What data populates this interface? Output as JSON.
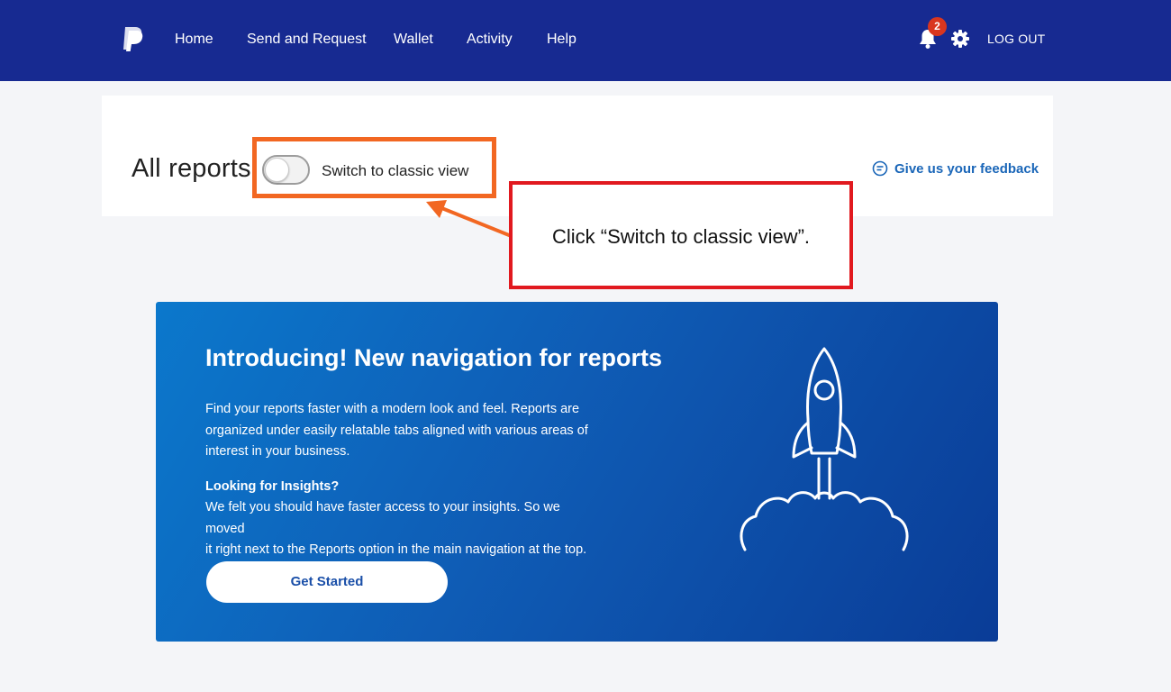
{
  "nav": {
    "items": [
      {
        "label": "Home"
      },
      {
        "label": "Send and Request"
      },
      {
        "label": "Wallet"
      },
      {
        "label": "Activity"
      },
      {
        "label": "Help"
      }
    ],
    "notification_count": "2",
    "logout_label": "LOG OUT",
    "icons": [
      "paypal-logo",
      "bell-icon",
      "gear-icon"
    ],
    "background_color": "#172a91"
  },
  "header": {
    "title": "All reports",
    "toggle_label": "Switch to classic view",
    "toggle_on": false,
    "feedback_label": "Give us your feedback"
  },
  "callout": {
    "text": "Click “Switch to classic view”.",
    "border_color": "#e1191f",
    "highlight_color": "#f26722"
  },
  "banner": {
    "title": "Introducing! New navigation for reports",
    "paragraph1_lines": [
      "Find your reports faster with a modern look and feel. Reports are",
      "organized under easily relatable tabs aligned with various areas of",
      "interest in your business."
    ],
    "subheading": "Looking for Insights?",
    "paragraph2_lines": [
      "We felt you should have faster access to your insights. So we moved",
      "it right next to the Reports option in the main navigation at the top."
    ],
    "button_label": "Get Started",
    "illustration": "rocket-icon"
  }
}
